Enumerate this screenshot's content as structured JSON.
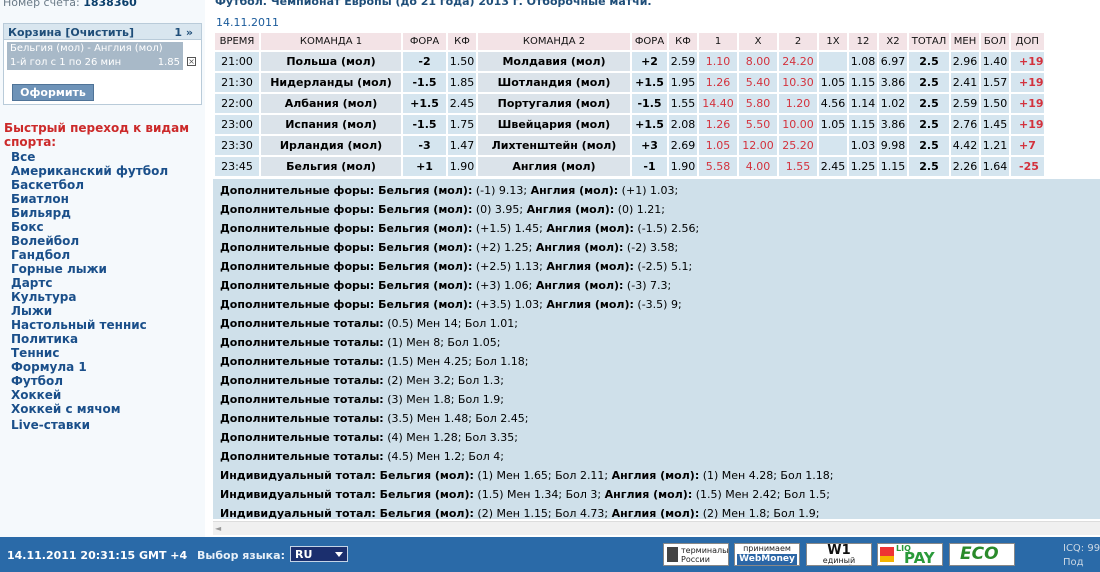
{
  "sidebar": {
    "account_label": "Номер счёта:",
    "account_number": "1838360",
    "cart_title": "Корзина [Очистить]",
    "cart_count": "1 »",
    "cart_item_line1": "Бельгия (мол) - Англия (мол)",
    "cart_item_line2": "1-й гол с 1 по 26 мин",
    "cart_item_coef": "1.85",
    "order_button": "Оформить",
    "quick_title": "Быстрый переход к видам спорта:",
    "sports": [
      "Все",
      "Американский футбол",
      "Баскетбол",
      "Биатлон",
      "Бильярд",
      "Бокс",
      "Волейбол",
      "Гандбол",
      "Горные лыжи",
      "Дартс",
      "Культура",
      "Лыжи",
      "Настольный теннис",
      "Политика",
      "Теннис",
      "Формула 1",
      "Футбол",
      "Хоккей",
      "Хоккей с мячом",
      "Live-ставки"
    ]
  },
  "main": {
    "league_title": "Футбол. Чемпионат Европы (до 21 года) 2013 г. Отборочные матчи.",
    "date": "14.11.2011",
    "columns": [
      "ВРЕМЯ",
      "КОМАНДА 1",
      "ФОРА",
      "КФ",
      "КОМАНДА 2",
      "ФОРА",
      "КФ",
      "1",
      "X",
      "2",
      "1X",
      "12",
      "X2",
      "ТОТАЛ",
      "МЕН",
      "БОЛ",
      "ДОП"
    ],
    "rows": [
      [
        "21:00",
        "Польша (мол)",
        "-2",
        "1.50",
        "Молдавия (мол)",
        "+2",
        "2.59",
        "1.10",
        "8.00",
        "24.20",
        "",
        "1.08",
        "6.97",
        "2.5",
        "2.96",
        "1.40",
        "+19"
      ],
      [
        "21:30",
        "Нидерланды (мол)",
        "-1.5",
        "1.85",
        "Шотландия (мол)",
        "+1.5",
        "1.95",
        "1.26",
        "5.40",
        "10.30",
        "1.05",
        "1.15",
        "3.86",
        "2.5",
        "2.41",
        "1.57",
        "+19"
      ],
      [
        "22:00",
        "Албания (мол)",
        "+1.5",
        "2.45",
        "Португалия (мол)",
        "-1.5",
        "1.55",
        "14.40",
        "5.80",
        "1.20",
        "4.56",
        "1.14",
        "1.02",
        "2.5",
        "2.59",
        "1.50",
        "+19"
      ],
      [
        "23:00",
        "Испания (мол)",
        "-1.5",
        "1.75",
        "Швейцария (мол)",
        "+1.5",
        "2.08",
        "1.26",
        "5.50",
        "10.00",
        "1.05",
        "1.15",
        "3.86",
        "2.5",
        "2.76",
        "1.45",
        "+19"
      ],
      [
        "23:30",
        "Ирландия (мол)",
        "-3",
        "1.47",
        "Лихтенштейн (мол)",
        "+3",
        "2.69",
        "1.05",
        "12.00",
        "25.20",
        "",
        "1.03",
        "9.98",
        "2.5",
        "4.42",
        "1.21",
        "+7"
      ],
      [
        "23:45",
        "Бельгия (мол)",
        "+1",
        "1.90",
        "Англия (мол)",
        "-1",
        "1.90",
        "5.58",
        "4.00",
        "1.55",
        "2.45",
        "1.25",
        "1.15",
        "2.5",
        "2.26",
        "1.64",
        "-25"
      ]
    ],
    "extra_lines": [
      [
        "Дополнительные форы: Бельгия (мол):",
        " (-1) 9.13; ",
        "Англия (мол):",
        " (+1) 1.03;"
      ],
      [
        "Дополнительные форы: Бельгия (мол):",
        " (0) 3.95; ",
        "Англия (мол):",
        " (0) 1.21;"
      ],
      [
        "Дополнительные форы: Бельгия (мол):",
        " (+1.5) 1.45; ",
        "Англия (мол):",
        " (-1.5) 2.56;"
      ],
      [
        "Дополнительные форы: Бельгия (мол):",
        " (+2) 1.25; ",
        "Англия (мол):",
        " (-2) 3.58;"
      ],
      [
        "Дополнительные форы: Бельгия (мол):",
        " (+2.5) 1.13; ",
        "Англия (мол):",
        " (-2.5) 5.1;"
      ],
      [
        "Дополнительные форы: Бельгия (мол):",
        " (+3) 1.06; ",
        "Англия (мол):",
        " (-3) 7.3;"
      ],
      [
        "Дополнительные форы: Бельгия (мол):",
        " (+3.5) 1.03; ",
        "Англия (мол):",
        " (-3.5) 9;"
      ],
      [
        "Дополнительные тоталы:",
        " (0.5) Мен 14; Бол 1.01;",
        "",
        ""
      ],
      [
        "Дополнительные тоталы:",
        " (1) Мен 8; Бол 1.05;",
        "",
        ""
      ],
      [
        "Дополнительные тоталы:",
        " (1.5) Мен 4.25; Бол 1.18;",
        "",
        ""
      ],
      [
        "Дополнительные тоталы:",
        " (2) Мен 3.2; Бол 1.3;",
        "",
        ""
      ],
      [
        "Дополнительные тоталы:",
        " (3) Мен 1.8; Бол 1.9;",
        "",
        ""
      ],
      [
        "Дополнительные тоталы:",
        " (3.5) Мен 1.48; Бол 2.45;",
        "",
        ""
      ],
      [
        "Дополнительные тоталы:",
        " (4) Мен 1.28; Бол 3.35;",
        "",
        ""
      ],
      [
        "Дополнительные тоталы:",
        " (4.5) Мен 1.2; Бол 4;",
        "",
        ""
      ],
      [
        "Индивидуальный тотал: Бельгия (мол):",
        " (1) Мен 1.65; Бол 2.11; ",
        "Англия (мол):",
        " (1) Мен 4.28; Бол 1.18;"
      ],
      [
        "Индивидуальный тотал: Бельгия (мол):",
        " (1.5) Мен 1.34; Бол 3; ",
        "Англия (мол):",
        " (1.5) Мен 2.42; Бол 1.5;"
      ],
      [
        "Индивидуальный тотал: Бельгия (мол):",
        " (2) Мен 1.15; Бол 4.73; ",
        "Англия (мол):",
        " (2) Мен 1.8; Бол 1.9;"
      ]
    ]
  },
  "footer": {
    "datetime": "14.11.2011  20:31:15  GMT +4",
    "lang_label": "Выбор языка:",
    "lang_value": "RU",
    "logo1": "терминалы России",
    "logo2_top": "принимаем",
    "logo2_brand": "WebMoney",
    "logo3_mark": "W1",
    "logo3_text": "единый кошелёк",
    "logo4_pre": "LIQ",
    "logo4_brand": "PAY",
    "logo5": "ECO",
    "icq": "ICQ: 99",
    "icq2": "Под"
  }
}
